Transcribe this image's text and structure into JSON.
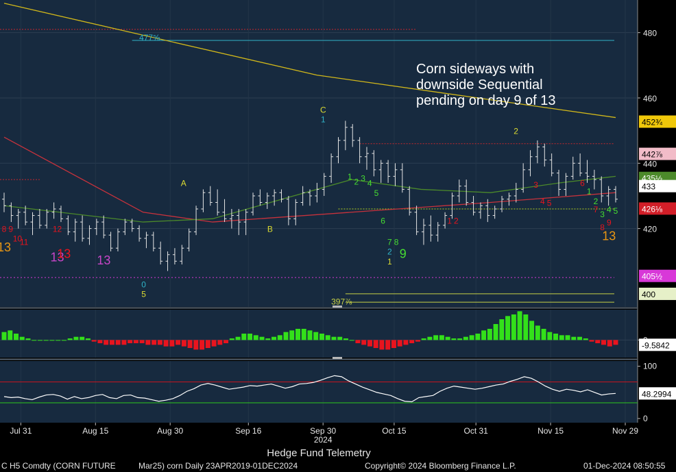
{
  "annotation": "Corn sideways with\ndownside Sequential\npending on day 9 of 13",
  "subtitle": "Hedge Fund Telemetry",
  "footer": {
    "security": "C H5 Comdty (CORN FUTURE",
    "contract": "Mar25) corn   Daily 23APR2019-01DEC2024",
    "copyright": "Copyright© 2024 Bloomberg Finance L.P.",
    "timestamp": "01-Dec-2024 08:50:55"
  },
  "colors": {
    "panel": "#172a3f",
    "grid": "#2c3e52",
    "bar": "#e6e6e6",
    "sma_long": "#d2b81a",
    "sma_mid": "#c8323c",
    "sma_short": "#4c8a2a",
    "hist_up": "#33e01a",
    "hist_down": "#e8141e",
    "rsi_line": "#ffffff",
    "rsi_upper": "#c8141e",
    "rsi_lower": "#2ec81e"
  },
  "chart_data": [
    {
      "type": "ohlc",
      "x_tick_labels": [
        "Jul 31",
        "Aug 15",
        "Aug 30",
        "Sep 16",
        "Sep 30",
        "Oct 15",
        "Oct 31",
        "Nov 15",
        "Nov 29"
      ],
      "x_year_label": "2024",
      "x_year_after_tick": 4,
      "ylim": [
        396,
        490
      ],
      "y_ticks": [
        420,
        440,
        460,
        480
      ],
      "bars": [
        [
          429,
          431,
          425,
          427
        ],
        [
          427,
          428,
          422,
          424
        ],
        [
          424,
          426,
          420,
          425
        ],
        [
          425,
          427,
          421,
          422
        ],
        [
          422,
          425,
          418,
          424
        ],
        [
          424,
          426,
          420,
          421
        ],
        [
          421,
          426,
          420,
          425
        ],
        [
          425,
          428,
          423,
          426
        ],
        [
          426,
          427,
          422,
          423
        ],
        [
          423,
          424,
          418,
          419
        ],
        [
          419,
          423,
          416,
          422
        ],
        [
          422,
          424,
          416,
          417
        ],
        [
          417,
          421,
          415,
          420
        ],
        [
          420,
          423,
          418,
          422
        ],
        [
          422,
          424,
          417,
          418
        ],
        [
          418,
          419,
          413,
          414
        ],
        [
          414,
          420,
          413,
          419
        ],
        [
          419,
          423,
          418,
          422
        ],
        [
          422,
          423,
          419,
          420
        ],
        [
          420,
          421,
          416,
          417
        ],
        [
          417,
          419,
          414,
          418
        ],
        [
          418,
          419,
          413,
          414
        ],
        [
          414,
          416,
          409,
          410
        ],
        [
          410,
          413,
          407,
          412
        ],
        [
          412,
          414,
          409,
          410
        ],
        [
          410,
          415,
          409,
          414
        ],
        [
          414,
          420,
          413,
          419
        ],
        [
          419,
          427,
          418,
          426
        ],
        [
          426,
          432,
          425,
          431
        ],
        [
          431,
          433,
          427,
          428
        ],
        [
          428,
          432,
          424,
          425
        ],
        [
          425,
          429,
          422,
          423
        ],
        [
          423,
          426,
          420,
          424
        ],
        [
          424,
          426,
          418,
          422
        ],
        [
          422,
          426,
          418,
          425
        ],
        [
          425,
          431,
          424,
          430
        ],
        [
          430,
          432,
          427,
          428
        ],
        [
          428,
          431,
          426,
          430
        ],
        [
          430,
          432,
          427,
          431
        ],
        [
          431,
          432,
          428,
          429
        ],
        [
          429,
          430,
          421,
          423
        ],
        [
          423,
          429,
          421,
          428
        ],
        [
          428,
          433,
          427,
          431
        ],
        [
          431,
          432,
          427,
          430
        ],
        [
          430,
          434,
          428,
          432
        ],
        [
          432,
          437,
          430,
          436
        ],
        [
          436,
          443,
          434,
          442
        ],
        [
          442,
          448,
          440,
          447
        ],
        [
          447,
          453,
          444,
          451
        ],
        [
          451,
          452,
          445,
          447
        ],
        [
          447,
          448,
          440,
          442
        ],
        [
          442,
          445,
          438,
          443
        ],
        [
          443,
          444,
          436,
          438
        ],
        [
          438,
          441,
          434,
          440
        ],
        [
          440,
          441,
          434,
          436
        ],
        [
          436,
          440,
          433,
          438
        ],
        [
          438,
          440,
          431,
          432
        ],
        [
          432,
          433,
          424,
          425
        ],
        [
          425,
          427,
          418,
          419
        ],
        [
          419,
          423,
          415,
          421
        ],
        [
          421,
          424,
          416,
          418
        ],
        [
          418,
          422,
          416,
          421
        ],
        [
          421,
          425,
          420,
          424
        ],
        [
          424,
          431,
          423,
          430
        ],
        [
          430,
          435,
          428,
          433
        ],
        [
          433,
          435,
          427,
          428
        ],
        [
          428,
          430,
          424,
          425
        ],
        [
          425,
          428,
          423,
          427
        ],
        [
          427,
          429,
          422,
          424
        ],
        [
          424,
          427,
          423,
          426
        ],
        [
          426,
          430,
          425,
          429
        ],
        [
          429,
          431,
          427,
          430
        ],
        [
          430,
          434,
          428,
          432
        ],
        [
          432,
          440,
          431,
          438
        ],
        [
          438,
          444,
          436,
          442
        ],
        [
          442,
          447,
          440,
          445
        ],
        [
          445,
          446,
          439,
          441
        ],
        [
          441,
          443,
          436,
          437
        ],
        [
          437,
          438,
          430,
          432
        ],
        [
          432,
          437,
          430,
          436
        ],
        [
          436,
          442,
          435,
          440
        ],
        [
          440,
          443,
          436,
          437
        ],
        [
          437,
          441,
          434,
          436
        ],
        [
          436,
          438,
          432,
          435
        ],
        [
          435,
          436,
          428,
          430
        ],
        [
          430,
          433,
          427,
          432
        ],
        [
          432,
          433,
          428,
          429
        ]
      ],
      "lines": [
        {
          "name_key": "sma_long",
          "values": [
            [
              0,
              489
            ],
            [
              45,
              467
            ],
            [
              88,
              454
            ]
          ]
        },
        {
          "name_key": "sma_mid",
          "values": [
            [
              0,
              448
            ],
            [
              20,
              425
            ],
            [
              30,
              422
            ],
            [
              50,
              425
            ],
            [
              70,
              428
            ],
            [
              88,
              431
            ]
          ]
        },
        {
          "name_key": "sma_short",
          "values": [
            [
              0,
              427
            ],
            [
              20,
              422
            ],
            [
              30,
              423
            ],
            [
              50,
              435
            ],
            [
              60,
              432
            ],
            [
              70,
              431
            ],
            [
              80,
              434
            ],
            [
              88,
              436
            ]
          ]
        }
      ],
      "hlines": [
        {
          "y": 477.625,
          "x0": 18,
          "x1": 88,
          "color": "#30b4c8",
          "dash": ""
        },
        {
          "y": 481,
          "x0": 0,
          "x1": 58,
          "color": "#c8282d",
          "dash": "2,2"
        },
        {
          "y": 405,
          "x0": 0,
          "x1": 88,
          "color": "#d838d8",
          "dash": "2,3"
        },
        {
          "y": 400,
          "x0": 48,
          "x1": 88,
          "color": "#c8d246",
          "dash": ""
        },
        {
          "y": 397.4375,
          "x0": 48,
          "x1": 88,
          "color": "#c8d246",
          "dash": ""
        },
        {
          "y": 446,
          "x0": 50,
          "x1": 88,
          "color": "#c8282d",
          "dash": "2,2"
        },
        {
          "y": 435,
          "x0": 0,
          "x1": 5,
          "color": "#c8282d",
          "dash": "2,2"
        },
        {
          "y": 426,
          "x0": 47,
          "x1": 88,
          "color": "#b4d21e",
          "dash": "2,2"
        }
      ],
      "axis_labels": [
        {
          "text": "452¾",
          "y": 452.75,
          "bg": "#f0c80a",
          "fg": "#000000"
        },
        {
          "text": "442⅞",
          "y": 442.875,
          "bg": "#f2bcc8",
          "fg": "#000000"
        },
        {
          "text": "435½",
          "y": 435.5,
          "bg": "#4c8a2a",
          "fg": "#ffffff"
        },
        {
          "text": "433",
          "y": 433,
          "bg": "#ffffff",
          "fg": "#000000"
        },
        {
          "text": "426⅛",
          "y": 426.125,
          "bg": "#d21e28",
          "fg": "#ffffff"
        },
        {
          "text": "405½",
          "y": 405.5,
          "bg": "#d838d8",
          "fg": "#ffffff"
        },
        {
          "text": "400",
          "y": 400,
          "bg": "#e6f0c8",
          "fg": "#000000"
        }
      ],
      "level_labels": [
        {
          "text": "477⅝",
          "y": 478.5,
          "x": 19,
          "color": "#30b4c8"
        },
        {
          "text": "397⅞",
          "y": 397.6,
          "x": 46,
          "color": "#c8d246"
        }
      ],
      "counts": [
        {
          "t": "9",
          "x": 1,
          "y": 419,
          "c": "#e8141e",
          "s": 12
        },
        {
          "t": "8",
          "x": 0,
          "y": 419,
          "c": "#e8141e",
          "s": 12
        },
        {
          "t": "10",
          "x": 2,
          "y": 416,
          "c": "#e8141e",
          "s": 12
        },
        {
          "t": "11",
          "x": 3,
          "y": 415,
          "c": "#e8141e",
          "s": 12
        },
        {
          "t": "12",
          "x": 8,
          "y": 419,
          "c": "#e8141e",
          "s": 12
        },
        {
          "t": "13",
          "x": 0,
          "y": 413,
          "c": "#e89614",
          "s": 18
        },
        {
          "t": "13",
          "x": 8,
          "y": 410,
          "c": "#c846c8",
          "s": 18
        },
        {
          "t": "13",
          "x": 9,
          "y": 411,
          "c": "#e8141e",
          "s": 18
        },
        {
          "t": "13",
          "x": 15,
          "y": 409,
          "c": "#c846c8",
          "s": 18
        },
        {
          "t": "0",
          "x": 21,
          "y": 402,
          "c": "#30b4c8",
          "s": 12
        },
        {
          "t": "5",
          "x": 21,
          "y": 399,
          "c": "#dcdc32",
          "s": 12
        },
        {
          "t": "A",
          "x": 27,
          "y": 433,
          "c": "#dcdc32",
          "s": 12
        },
        {
          "t": "B",
          "x": 40,
          "y": 419,
          "c": "#dcdc32",
          "s": 12
        },
        {
          "t": "C",
          "x": 48,
          "y": 455.5,
          "c": "#dcdc32",
          "s": 12
        },
        {
          "t": "1",
          "x": 48,
          "y": 452.5,
          "c": "#30b4c8",
          "s": 12
        },
        {
          "t": "1",
          "x": 52,
          "y": 435,
          "c": "#46dc32",
          "s": 12
        },
        {
          "t": "2",
          "x": 53,
          "y": 433.5,
          "c": "#46dc32",
          "s": 12
        },
        {
          "t": "3",
          "x": 54,
          "y": 434.5,
          "c": "#46dc32",
          "s": 12
        },
        {
          "t": "4",
          "x": 55,
          "y": 433,
          "c": "#46dc32",
          "s": 12
        },
        {
          "t": "5",
          "x": 56,
          "y": 430,
          "c": "#46dc32",
          "s": 12
        },
        {
          "t": "6",
          "x": 57,
          "y": 421.5,
          "c": "#46dc32",
          "s": 12
        },
        {
          "t": "7",
          "x": 58,
          "y": 415,
          "c": "#46dc32",
          "s": 12
        },
        {
          "t": "8",
          "x": 59,
          "y": 415,
          "c": "#46dc32",
          "s": 12
        },
        {
          "t": "2",
          "x": 58,
          "y": 412,
          "c": "#30b4c8",
          "s": 12
        },
        {
          "t": "1",
          "x": 58,
          "y": 409,
          "c": "#dcdc32",
          "s": 12
        },
        {
          "t": "9",
          "x": 60,
          "y": 411,
          "c": "#46dc32",
          "s": 18
        },
        {
          "t": "1",
          "x": 67,
          "y": 421.5,
          "c": "#e8141e",
          "s": 12
        },
        {
          "t": "2",
          "x": 68,
          "y": 421.5,
          "c": "#e8141e",
          "s": 12
        },
        {
          "t": "2",
          "x": 77,
          "y": 449,
          "c": "#dcdc32",
          "s": 12
        },
        {
          "t": "3",
          "x": 80,
          "y": 432.5,
          "c": "#e8141e",
          "s": 12
        },
        {
          "t": "4",
          "x": 81,
          "y": 427.5,
          "c": "#e8141e",
          "s": 12
        },
        {
          "t": "5",
          "x": 82,
          "y": 427,
          "c": "#e8141e",
          "s": 12
        },
        {
          "t": "6",
          "x": 87,
          "y": 433,
          "c": "#e8141e",
          "s": 12
        },
        {
          "t": "1",
          "x": 88,
          "y": 430.5,
          "c": "#46dc32",
          "s": 12
        },
        {
          "t": "2",
          "x": 89,
          "y": 427.5,
          "c": "#46dc32",
          "s": 12
        },
        {
          "t": "7",
          "x": 89,
          "y": 425,
          "c": "#e8141e",
          "s": 12
        },
        {
          "t": "3",
          "x": 90,
          "y": 423.5,
          "c": "#46dc32",
          "s": 12
        },
        {
          "t": "4",
          "x": 91,
          "y": 425,
          "c": "#46dc32",
          "s": 12
        },
        {
          "t": "5",
          "x": 92,
          "y": 424.5,
          "c": "#46dc32",
          "s": 12
        },
        {
          "t": "8",
          "x": 90,
          "y": 419.5,
          "c": "#e8141e",
          "s": 12
        },
        {
          "t": "9",
          "x": 91,
          "y": 421,
          "c": "#e8141e",
          "s": 12
        },
        {
          "t": "13",
          "x": 91,
          "y": 416.5,
          "c": "#e89614",
          "s": 18
        }
      ]
    },
    {
      "type": "bar",
      "name": "histogram",
      "last_value": "-9.5842",
      "y_ticks": [
        0
      ],
      "ylim": [
        -11,
        19
      ],
      "values": [
        5,
        6,
        4,
        2,
        1,
        0,
        0,
        0,
        0,
        0,
        0,
        1,
        2,
        2,
        1,
        -1,
        -2,
        -3,
        -3,
        -3,
        -3,
        -2,
        -2,
        -2,
        -3,
        -3,
        -3,
        -4,
        -4,
        -3,
        -4,
        -5,
        -6,
        -6,
        -5,
        -4,
        -3,
        -2,
        1,
        2,
        4,
        4,
        3,
        2,
        1,
        2,
        3,
        5,
        6,
        7,
        7,
        6,
        5,
        4,
        3,
        2,
        2,
        1,
        0,
        -2,
        -3,
        -4,
        -5,
        -6,
        -6,
        -5,
        -4,
        -3,
        -2,
        -1,
        1,
        2,
        3,
        3,
        2,
        1,
        1,
        2,
        3,
        4,
        6,
        7,
        10,
        13,
        15,
        16,
        18,
        16,
        12,
        9,
        7,
        5,
        4,
        3,
        3,
        2,
        2,
        1,
        -1,
        -2,
        -3,
        -4,
        -3
      ]
    },
    {
      "type": "line",
      "name": "rsi",
      "last_value": "48.2994",
      "y_ticks": [
        0,
        100
      ],
      "ylim": [
        -8,
        110
      ],
      "upper": 70,
      "lower": 30,
      "values": [
        42,
        40,
        41,
        38,
        36,
        41,
        45,
        46,
        43,
        37,
        42,
        38,
        40,
        44,
        46,
        40,
        38,
        44,
        45,
        40,
        39,
        36,
        33,
        35,
        38,
        44,
        52,
        57,
        64,
        67,
        64,
        60,
        56,
        58,
        60,
        63,
        62,
        64,
        66,
        62,
        58,
        61,
        66,
        67,
        69,
        73,
        78,
        82,
        80,
        72,
        66,
        60,
        55,
        50,
        47,
        44,
        38,
        33,
        32,
        40,
        42,
        44,
        52,
        58,
        62,
        60,
        58,
        56,
        58,
        61,
        64,
        66,
        71,
        75,
        80,
        77,
        70,
        62,
        56,
        52,
        56,
        54,
        51,
        55,
        50,
        45,
        47,
        48
      ]
    }
  ]
}
